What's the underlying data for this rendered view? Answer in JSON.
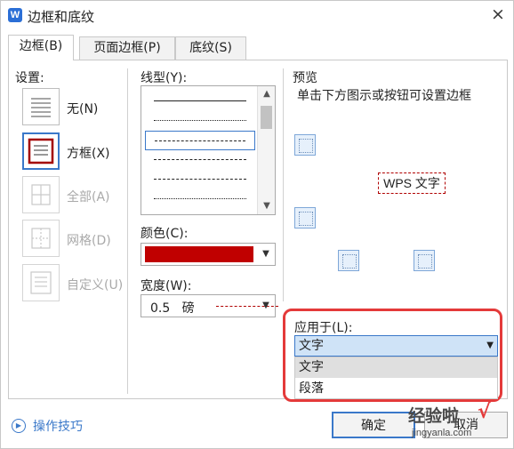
{
  "window": {
    "title": "边框和底纹",
    "app_icon_letter": "W",
    "close_symbol": "×"
  },
  "tabs": [
    {
      "label": "边框(B)",
      "active": true
    },
    {
      "label": "页面边框(P)",
      "active": false
    },
    {
      "label": "底纹(S)",
      "active": false
    }
  ],
  "settings": {
    "label": "设置:",
    "items": [
      {
        "label": "无(N)",
        "state": "normal"
      },
      {
        "label": "方框(X)",
        "state": "selected"
      },
      {
        "label": "全部(A)",
        "state": "disabled"
      },
      {
        "label": "网格(D)",
        "state": "disabled"
      },
      {
        "label": "自定义(U)",
        "state": "disabled"
      }
    ]
  },
  "line_style": {
    "label": "线型(Y):",
    "options": [
      "solid",
      "dotted",
      "dashed-small",
      "dashed",
      "dash-dot",
      "dash-dot-dot"
    ],
    "selected_index": 2
  },
  "color": {
    "label": "颜色(C):",
    "value": "#c00000"
  },
  "width": {
    "label": "宽度(W):",
    "value": "0.5",
    "unit": "磅"
  },
  "preview": {
    "title": "预览",
    "hint": "单击下方图示或按钮可设置边框",
    "sample_text": "WPS 文字"
  },
  "apply_to": {
    "label": "应用于(L):",
    "selected": "文字",
    "options": [
      "文字",
      "段落"
    ],
    "highlighted_index": 0
  },
  "footer": {
    "tips_label": "操作技巧",
    "ok_label": "确定",
    "cancel_label": "取消"
  },
  "watermark": {
    "main": "经验啦",
    "check": "√",
    "sub": "jingyanla.com"
  },
  "colors": {
    "accent": "#3a78c9",
    "highlight_border": "#e43a3a",
    "border_red": "#c00000"
  }
}
